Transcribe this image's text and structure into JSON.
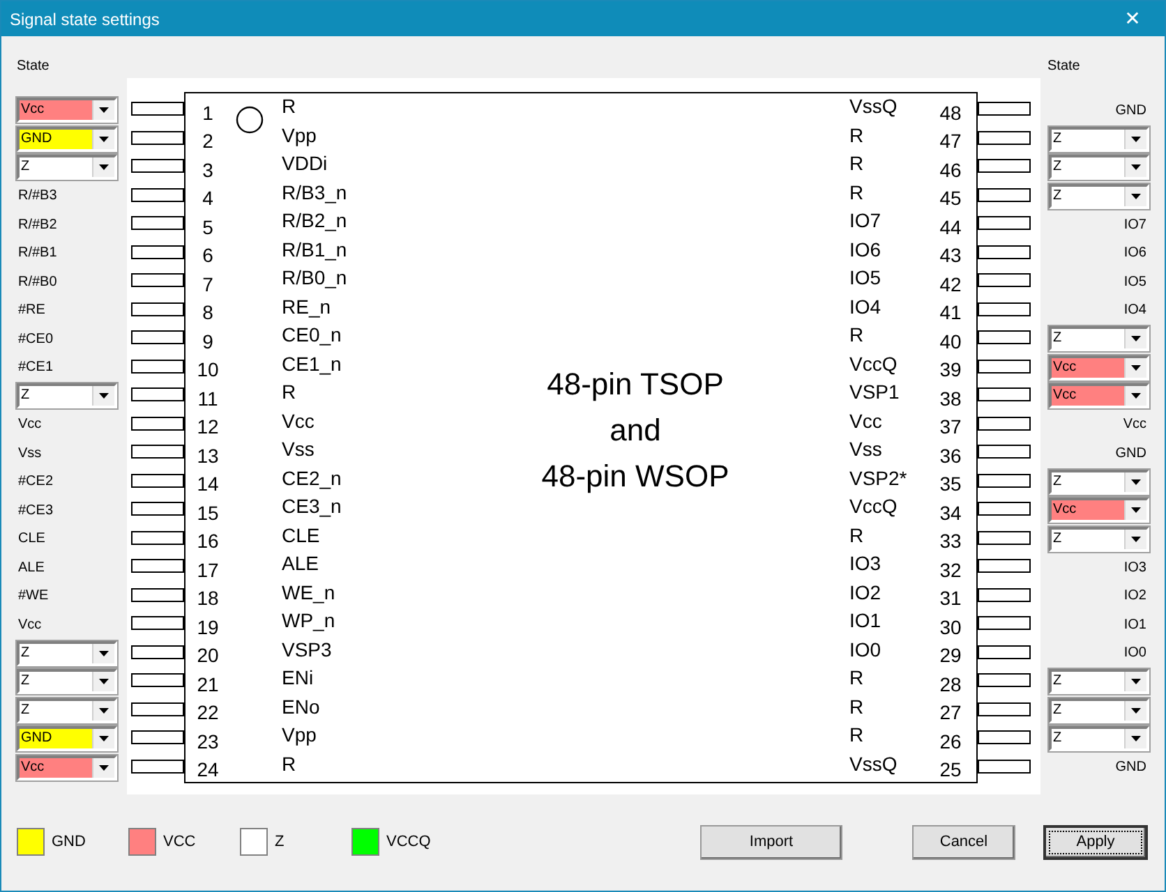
{
  "window": {
    "title": "Signal state settings",
    "close": "✕"
  },
  "state_headers": {
    "left": "State",
    "right": "State"
  },
  "chip": {
    "caption": [
      "48-pin TSOP",
      "and",
      "48-pin WSOP"
    ],
    "pin1_marker": true
  },
  "left_pins": [
    {
      "number": "1",
      "name": "R",
      "state": {
        "kind": "select",
        "value": "Vcc",
        "color": "#ff8080"
      }
    },
    {
      "number": "2",
      "name": "Vpp",
      "state": {
        "kind": "select",
        "value": "GND",
        "color": "#ffff00"
      }
    },
    {
      "number": "3",
      "name": "VDDi",
      "state": {
        "kind": "select",
        "value": "Z",
        "color": "#ffffff"
      }
    },
    {
      "number": "4",
      "name": "R/B3_n",
      "state": {
        "kind": "label",
        "text": "R/#B3"
      }
    },
    {
      "number": "5",
      "name": "R/B2_n",
      "state": {
        "kind": "label",
        "text": "R/#B2"
      }
    },
    {
      "number": "6",
      "name": "R/B1_n",
      "state": {
        "kind": "label",
        "text": "R/#B1"
      }
    },
    {
      "number": "7",
      "name": "R/B0_n",
      "state": {
        "kind": "label",
        "text": "R/#B0"
      }
    },
    {
      "number": "8",
      "name": "RE_n",
      "state": {
        "kind": "label",
        "text": "#RE"
      }
    },
    {
      "number": "9",
      "name": "CE0_n",
      "state": {
        "kind": "label",
        "text": "#CE0"
      }
    },
    {
      "number": "10",
      "name": "CE1_n",
      "state": {
        "kind": "label",
        "text": "#CE1"
      }
    },
    {
      "number": "11",
      "name": "R",
      "state": {
        "kind": "select",
        "value": "Z",
        "color": "#ffffff"
      }
    },
    {
      "number": "12",
      "name": "Vcc",
      "state": {
        "kind": "label",
        "text": "Vcc"
      }
    },
    {
      "number": "13",
      "name": "Vss",
      "state": {
        "kind": "label",
        "text": "Vss"
      }
    },
    {
      "number": "14",
      "name": "CE2_n",
      "state": {
        "kind": "label",
        "text": "#CE2"
      }
    },
    {
      "number": "15",
      "name": "CE3_n",
      "state": {
        "kind": "label",
        "text": "#CE3"
      }
    },
    {
      "number": "16",
      "name": "CLE",
      "state": {
        "kind": "label",
        "text": "CLE"
      }
    },
    {
      "number": "17",
      "name": "ALE",
      "state": {
        "kind": "label",
        "text": "ALE"
      }
    },
    {
      "number": "18",
      "name": "WE_n",
      "state": {
        "kind": "label",
        "text": "#WE"
      }
    },
    {
      "number": "19",
      "name": "WP_n",
      "state": {
        "kind": "label",
        "text": "Vcc"
      }
    },
    {
      "number": "20",
      "name": "VSP3",
      "state": {
        "kind": "select",
        "value": "Z",
        "color": "#ffffff"
      }
    },
    {
      "number": "21",
      "name": "ENi",
      "state": {
        "kind": "select",
        "value": "Z",
        "color": "#ffffff"
      }
    },
    {
      "number": "22",
      "name": "ENo",
      "state": {
        "kind": "select",
        "value": "Z",
        "color": "#ffffff"
      }
    },
    {
      "number": "23",
      "name": "Vpp",
      "state": {
        "kind": "select",
        "value": "GND",
        "color": "#ffff00"
      }
    },
    {
      "number": "24",
      "name": "R",
      "state": {
        "kind": "select",
        "value": "Vcc",
        "color": "#ff8080"
      }
    }
  ],
  "right_pins": [
    {
      "number": "48",
      "name": "VssQ",
      "state": {
        "kind": "label",
        "text": "GND"
      }
    },
    {
      "number": "47",
      "name": "R",
      "state": {
        "kind": "select",
        "value": "Z",
        "color": "#ffffff"
      }
    },
    {
      "number": "46",
      "name": "R",
      "state": {
        "kind": "select",
        "value": "Z",
        "color": "#ffffff"
      }
    },
    {
      "number": "45",
      "name": "R",
      "state": {
        "kind": "select",
        "value": "Z",
        "color": "#ffffff"
      }
    },
    {
      "number": "44",
      "name": "IO7",
      "state": {
        "kind": "label",
        "text": "IO7"
      }
    },
    {
      "number": "43",
      "name": "IO6",
      "state": {
        "kind": "label",
        "text": "IO6"
      }
    },
    {
      "number": "42",
      "name": "IO5",
      "state": {
        "kind": "label",
        "text": "IO5"
      }
    },
    {
      "number": "41",
      "name": "IO4",
      "state": {
        "kind": "label",
        "text": "IO4"
      }
    },
    {
      "number": "40",
      "name": "R",
      "state": {
        "kind": "select",
        "value": "Z",
        "color": "#ffffff"
      }
    },
    {
      "number": "39",
      "name": "VccQ",
      "state": {
        "kind": "select",
        "value": "Vcc",
        "color": "#ff8080"
      }
    },
    {
      "number": "38",
      "name": "VSP1",
      "state": {
        "kind": "select",
        "value": "Vcc",
        "color": "#ff8080"
      }
    },
    {
      "number": "37",
      "name": "Vcc",
      "state": {
        "kind": "label",
        "text": "Vcc"
      }
    },
    {
      "number": "36",
      "name": "Vss",
      "state": {
        "kind": "label",
        "text": "GND"
      }
    },
    {
      "number": "35",
      "name": "VSP2*",
      "state": {
        "kind": "select",
        "value": "Z",
        "color": "#ffffff"
      }
    },
    {
      "number": "34",
      "name": "VccQ",
      "state": {
        "kind": "select",
        "value": "Vcc",
        "color": "#ff8080"
      }
    },
    {
      "number": "33",
      "name": "R",
      "state": {
        "kind": "select",
        "value": "Z",
        "color": "#ffffff"
      }
    },
    {
      "number": "32",
      "name": "IO3",
      "state": {
        "kind": "label",
        "text": "IO3"
      }
    },
    {
      "number": "31",
      "name": "IO2",
      "state": {
        "kind": "label",
        "text": "IO2"
      }
    },
    {
      "number": "30",
      "name": "IO1",
      "state": {
        "kind": "label",
        "text": "IO1"
      }
    },
    {
      "number": "29",
      "name": "IO0",
      "state": {
        "kind": "label",
        "text": "IO0"
      }
    },
    {
      "number": "28",
      "name": "R",
      "state": {
        "kind": "select",
        "value": "Z",
        "color": "#ffffff"
      }
    },
    {
      "number": "27",
      "name": "R",
      "state": {
        "kind": "select",
        "value": "Z",
        "color": "#ffffff"
      }
    },
    {
      "number": "26",
      "name": "R",
      "state": {
        "kind": "select",
        "value": "Z",
        "color": "#ffffff"
      }
    },
    {
      "number": "25",
      "name": "VssQ",
      "state": {
        "kind": "label",
        "text": "GND"
      }
    }
  ],
  "legend": [
    {
      "label": "GND",
      "color": "#ffff00"
    },
    {
      "label": "VCC",
      "color": "#ff8080"
    },
    {
      "label": "Z",
      "color": "#ffffff"
    },
    {
      "label": "VCCQ",
      "color": "#00ff00"
    }
  ],
  "buttons": [
    {
      "label": "Import",
      "default": false
    },
    {
      "label": "Cancel",
      "default": false
    },
    {
      "label": "Apply",
      "default": true
    }
  ]
}
